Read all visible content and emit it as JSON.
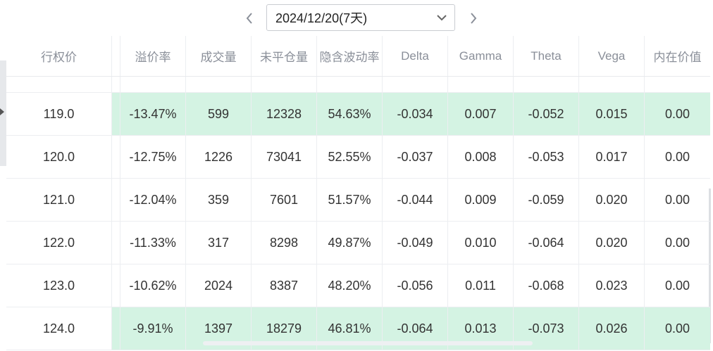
{
  "date_nav": {
    "selected_date": "2024/12/20(7天)",
    "prev_icon": "chevron-left-icon",
    "next_icon": "chevron-right-icon",
    "dropdown_icon": "chevron-down-icon"
  },
  "table": {
    "columns": [
      "行权价",
      "溢价率",
      "成交量",
      "未平仓量",
      "隐含波动率",
      "Delta",
      "Gamma",
      "Theta",
      "Vega",
      "内在价值"
    ],
    "rows": [
      {
        "strike": "119.0",
        "premium": "-13.47%",
        "volume": "599",
        "open_interest": "12328",
        "iv": "54.63%",
        "delta": "-0.034",
        "gamma": "0.007",
        "theta": "-0.052",
        "vega": "0.015",
        "intrinsic": "0.00",
        "highlighted": true
      },
      {
        "strike": "120.0",
        "premium": "-12.75%",
        "volume": "1226",
        "open_interest": "73041",
        "iv": "52.55%",
        "delta": "-0.037",
        "gamma": "0.008",
        "theta": "-0.053",
        "vega": "0.017",
        "intrinsic": "0.00",
        "highlighted": false
      },
      {
        "strike": "121.0",
        "premium": "-12.04%",
        "volume": "359",
        "open_interest": "7601",
        "iv": "51.57%",
        "delta": "-0.044",
        "gamma": "0.009",
        "theta": "-0.059",
        "vega": "0.020",
        "intrinsic": "0.00",
        "highlighted": false
      },
      {
        "strike": "122.0",
        "premium": "-11.33%",
        "volume": "317",
        "open_interest": "8298",
        "iv": "49.87%",
        "delta": "-0.049",
        "gamma": "0.010",
        "theta": "-0.064",
        "vega": "0.020",
        "intrinsic": "0.00",
        "highlighted": false
      },
      {
        "strike": "123.0",
        "premium": "-10.62%",
        "volume": "2024",
        "open_interest": "8387",
        "iv": "48.20%",
        "delta": "-0.056",
        "gamma": "0.011",
        "theta": "-0.068",
        "vega": "0.023",
        "intrinsic": "0.00",
        "highlighted": false
      },
      {
        "strike": "124.0",
        "premium": "-9.91%",
        "volume": "1397",
        "open_interest": "18279",
        "iv": "46.81%",
        "delta": "-0.064",
        "gamma": "0.013",
        "theta": "-0.073",
        "vega": "0.026",
        "intrinsic": "0.00",
        "highlighted": true
      }
    ]
  },
  "colors": {
    "highlight_row": "#d4f3e3",
    "header_text": "#8a8f99",
    "cell_text": "#333333"
  }
}
